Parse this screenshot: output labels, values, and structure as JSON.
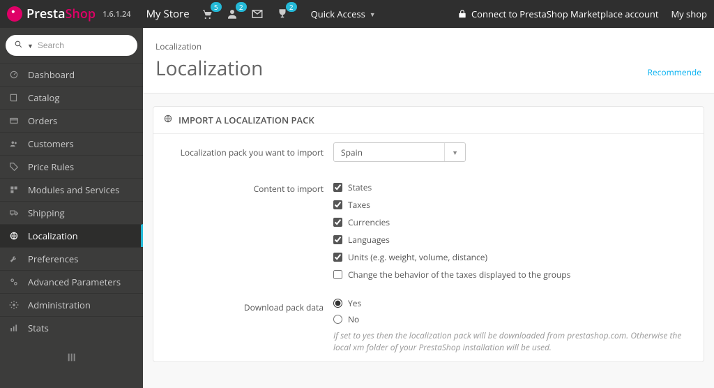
{
  "header": {
    "brand": {
      "presta": "Presta",
      "shop": "Shop",
      "version": "1.6.1.24"
    },
    "store_name": "My Store",
    "badges": {
      "cart": "5",
      "user": "2",
      "trophy": "2"
    },
    "quick_access": "Quick Access",
    "connect": "Connect to PrestaShop Marketplace account",
    "my_shop": "My shop"
  },
  "search": {
    "placeholder": "Search"
  },
  "nav": {
    "dashboard": "Dashboard",
    "catalog": "Catalog",
    "orders": "Orders",
    "customers": "Customers",
    "price_rules": "Price Rules",
    "modules": "Modules and Services",
    "shipping": "Shipping",
    "localization": "Localization",
    "preferences": "Preferences",
    "advanced": "Advanced Parameters",
    "administration": "Administration",
    "stats": "Stats"
  },
  "page": {
    "breadcrumb": "Localization",
    "title": "Localization",
    "recommended": "Recommende"
  },
  "panel": {
    "title": "IMPORT A LOCALIZATION PACK",
    "fields": {
      "pack_label": "Localization pack you want to import",
      "pack_value": "Spain",
      "content_label": "Content to import",
      "content_options": {
        "states": {
          "label": "States",
          "checked": true
        },
        "taxes": {
          "label": "Taxes",
          "checked": true
        },
        "currencies": {
          "label": "Currencies",
          "checked": true
        },
        "languages": {
          "label": "Languages",
          "checked": true
        },
        "units": {
          "label": "Units (e.g. weight, volume, distance)",
          "checked": true
        },
        "behavior": {
          "label": "Change the behavior of the taxes displayed to the groups",
          "checked": false
        }
      },
      "download_label": "Download pack data",
      "download_options": {
        "yes": "Yes",
        "no": "No",
        "selected": "yes"
      },
      "download_help": "If set to yes then the localization pack will be downloaded from prestashop.com. Otherwise the local xm folder of your PrestaShop installation will be used."
    }
  }
}
